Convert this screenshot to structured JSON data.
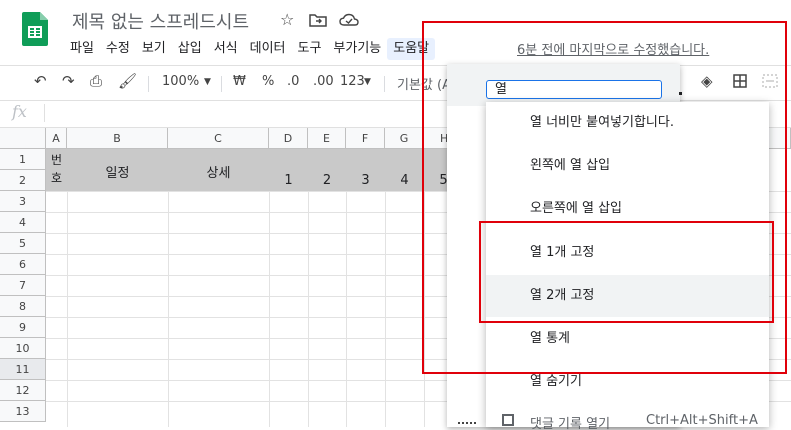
{
  "doc": {
    "title": "제목 없는 스프레드시트",
    "last_edit": "6분 전에 마지막으로 수정했습니다."
  },
  "menubar": [
    "파일",
    "수정",
    "보기",
    "삽입",
    "서식",
    "데이터",
    "도구",
    "부가기능",
    "도움말"
  ],
  "toolbar": {
    "zoom": "100%",
    "currency": "₩",
    "percent": "%",
    "decimal_less": ".0",
    "decimal_more": ".00",
    "format_more": "123",
    "font": "기본값 (A"
  },
  "formula_bar": {
    "fx": "fx"
  },
  "grid": {
    "columns": [
      "A",
      "B",
      "C",
      "D",
      "E",
      "F",
      "G",
      "H"
    ],
    "rows": [
      "1",
      "2",
      "3",
      "4",
      "5",
      "6",
      "7",
      "8",
      "9",
      "10",
      "11",
      "12",
      "13"
    ],
    "header_cells": {
      "a": "번호",
      "b": "일정",
      "c": "상세"
    },
    "day_numbers": [
      "1",
      "2",
      "3",
      "4",
      "5"
    ]
  },
  "help_menu": {
    "search_value": "열",
    "items": [
      "열 너비만 붙여넣기합니다.",
      "왼쪽에 열 삽입",
      "오른쪽에 열 삽입",
      "열 1개 고정",
      "열 2개 고정",
      "열 통계",
      "열 숨기기"
    ],
    "partial_item": "댓글 기록 열기",
    "partial_shortcut": "Ctrl+Alt+Shift+A"
  },
  "colors": {
    "accent": "#1a73e8",
    "highlight_box": "#e0000a",
    "sheets_green": "#0f9d58",
    "header_gray": "#c9c9c9"
  }
}
